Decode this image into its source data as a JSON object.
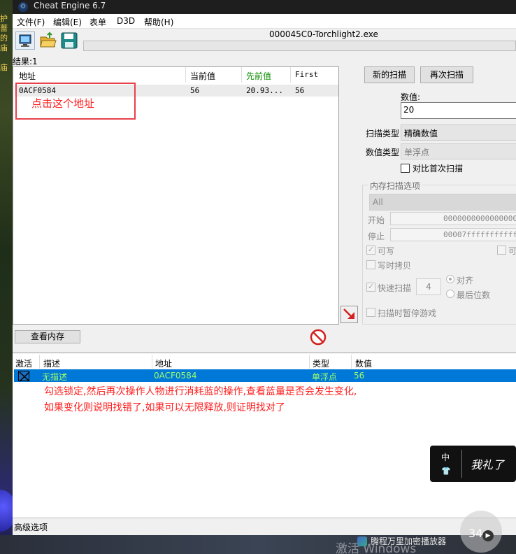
{
  "game_bg": {
    "left_text": "护\n蔷\n的\n庙\n\n庙\n"
  },
  "window": {
    "title": "Cheat Engine 6.7",
    "process_title": "000045C0-Torchlight2.exe",
    "results_label": "结果:1"
  },
  "menu": [
    "文件(F)",
    "编辑(E)",
    "表单",
    "D3D",
    "帮助(H)"
  ],
  "result_list": {
    "headers": [
      "地址",
      "当前值",
      "先前值",
      "First"
    ],
    "header_colors": {
      "previous": "#0a8c00"
    },
    "rows": [
      {
        "address": "0ACF0584",
        "current": "56",
        "previous": "20.93...",
        "first": "56"
      }
    ],
    "annotation": "点击这个地址"
  },
  "scan": {
    "new_scan": "新的扫描",
    "next_scan": "再次扫描",
    "value_label": "数值:",
    "value": "20",
    "scan_type_label": "扫描类型",
    "scan_type": "精确数值",
    "value_type_label": "数值类型",
    "value_type": "单浮点",
    "compare_first": "对比首次扫描"
  },
  "memory": {
    "title": "内存扫描选项",
    "region": "All",
    "start_label": "开始",
    "start_value": "0000000000000000",
    "stop_label": "停止",
    "stop_value": "00007fffffffffff",
    "writable": "可写",
    "executable": "可",
    "copy_on_write": "写时拷贝",
    "fast_scan": "快速扫描",
    "fast_scan_value": "4",
    "align": "对齐",
    "last_digits": "最后位数",
    "pause_game": "扫描时暂停游戏"
  },
  "buttons": {
    "view_memory": "查看内存"
  },
  "address_list": {
    "headers": [
      "激活",
      "描述",
      "地址",
      "类型",
      "数值"
    ],
    "rows": [
      {
        "description": "无描述",
        "address": "0ACF0584",
        "type": "单浮点",
        "value": "56"
      }
    ],
    "annotation_line1": "勾选锁定,然后再次操作人物进行消耗蓝的操作,查看蓝量是否会发生变化,",
    "annotation_line2": "如果变化则说明找错了,如果可以无限释放,则证明找对了"
  },
  "status": {
    "advanced": "高级选项"
  },
  "overlays": {
    "ime_lang": "中",
    "ime_shirt": "👕",
    "ime_text": "我礼了",
    "tencent_num": "34",
    "activate_windows": "激活 Windows",
    "player": "腾程万里加密播放器"
  }
}
